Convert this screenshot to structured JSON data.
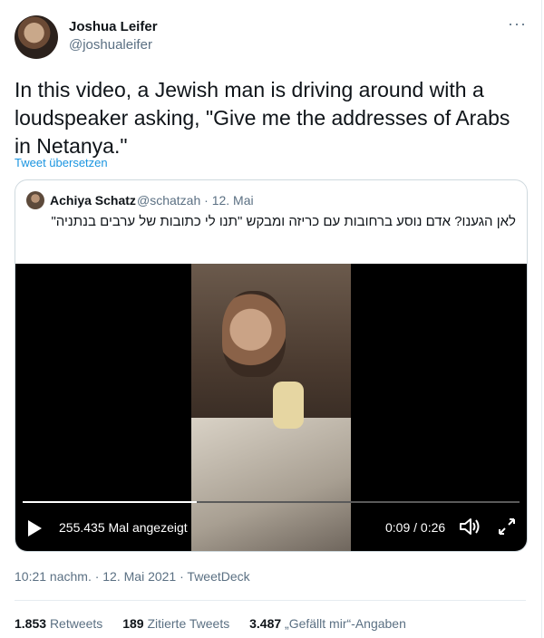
{
  "author": {
    "name": "Joshua Leifer",
    "handle": "@joshualeifer",
    "more_label": "···"
  },
  "tweet": {
    "text": "In this video, a Jewish man is driving around with a loudspeaker asking, \"Give me the addresses of Arabs in Netanya.\"",
    "translate_label": "Tweet übersetzen"
  },
  "quote": {
    "name": "Achiya Schatz",
    "handle": "@schatzah",
    "date": "· 12. Mai",
    "text": "לאן הגענו? אדם נוסע ברחובות עם כריזה ומבקש \"תנו לי כתובות של ערבים בנתניה\"",
    "video": {
      "views": "255.435 Mal angezeigt",
      "time": "0:09 / 0:26",
      "progress": 0.35
    }
  },
  "meta": {
    "timestamp": "10:21 nachm. · 12. Mai 2021 · TweetDeck"
  },
  "stats": {
    "retweets_count": "1.853",
    "retweets_label": "Retweets",
    "quotes_count": "189",
    "quotes_label": "Zitierte Tweets",
    "likes_count": "3.487",
    "likes_label": "„Gefällt mir“-Angaben"
  },
  "colors": {
    "link": "#1b95e0",
    "secondary_text": "#5b7083",
    "primary_text": "#0f1419"
  },
  "icons": [
    "more-icon",
    "play-icon",
    "volume-icon",
    "fullscreen-icon"
  ]
}
